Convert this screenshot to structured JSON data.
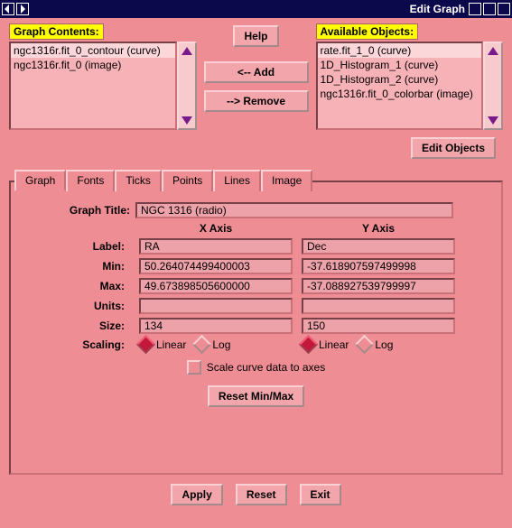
{
  "window": {
    "title": "Edit Graph"
  },
  "panels": {
    "contents_label": "Graph Contents:",
    "available_label": "Available Objects:"
  },
  "graph_contents": [
    "ngc1316r.fit_0_contour (curve)",
    "ngc1316r.fit_0 (image)"
  ],
  "available_objects": [
    "rate.fit_1_0 (curve)",
    "1D_Histogram_1 (curve)",
    "1D_Histogram_2 (curve)",
    "ngc1316r.fit_0_colorbar (image)"
  ],
  "buttons": {
    "help": "Help",
    "add": "<-- Add",
    "remove": "--> Remove",
    "edit_objects": "Edit Objects",
    "reset_minmax": "Reset Min/Max",
    "apply": "Apply",
    "reset": "Reset",
    "exit": "Exit"
  },
  "tabs": [
    "Graph",
    "Fonts",
    "Ticks",
    "Points",
    "Lines",
    "Image"
  ],
  "form": {
    "title_label": "Graph Title:",
    "title_value": "NGC 1316 (radio)",
    "axis_headers": {
      "x": "X Axis",
      "y": "Y Axis"
    },
    "row_labels": {
      "label": "Label:",
      "min": "Min:",
      "max": "Max:",
      "units": "Units:",
      "size": "Size:",
      "scaling": "Scaling:"
    },
    "x": {
      "label": "RA",
      "min": "50.264074499400003",
      "max": "49.673898505600000",
      "units": "",
      "size": "134",
      "scaling": "Linear"
    },
    "y": {
      "label": "Dec",
      "min": "-37.618907597499998",
      "max": "-37.088927539799997",
      "units": "",
      "size": "150",
      "scaling": "Linear"
    },
    "scale_options": {
      "linear": "Linear",
      "log": "Log"
    },
    "scale_checkbox": "Scale curve data to axes"
  }
}
